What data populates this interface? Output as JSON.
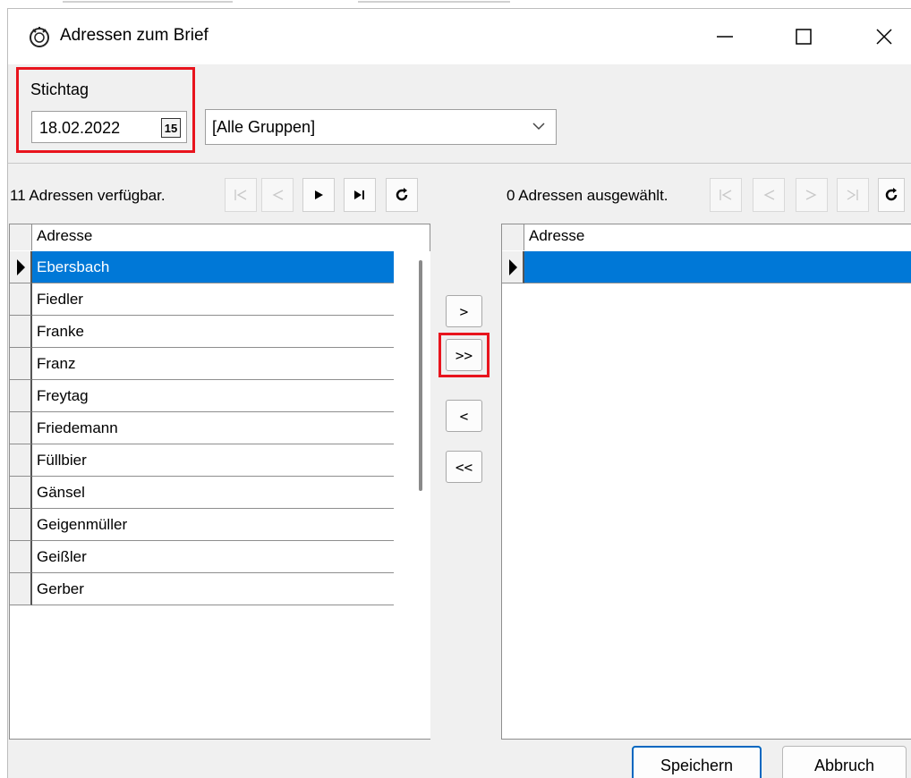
{
  "window": {
    "title": "Adressen zum Brief"
  },
  "stichtag": {
    "label": "Stichtag",
    "date": "18.02.2022",
    "calendar_button": "15"
  },
  "group_filter": {
    "selected": "[Alle Gruppen]"
  },
  "available": {
    "count_label": "11 Adressen verfügbar.",
    "column_header": "Adresse",
    "rows": [
      "Ebersbach",
      "Fiedler",
      "Franke",
      "Franz",
      "Freytag",
      "Friedemann",
      "Füllbier",
      "Gänsel",
      "Geigenmüller",
      "Geißler",
      "Gerber"
    ],
    "selected_index": 0
  },
  "selected": {
    "count_label": "0 Adressen ausgewählt.",
    "column_header": "Adresse"
  },
  "move_buttons": {
    "add_one": ">",
    "add_all": ">>",
    "remove_one": "<",
    "remove_all": "<<"
  },
  "footer": {
    "save": "Speichern",
    "cancel": "Abbruch"
  },
  "colors": {
    "selection": "#0078d7",
    "highlight": "#e8141d",
    "default_button_border": "#0067c0"
  }
}
